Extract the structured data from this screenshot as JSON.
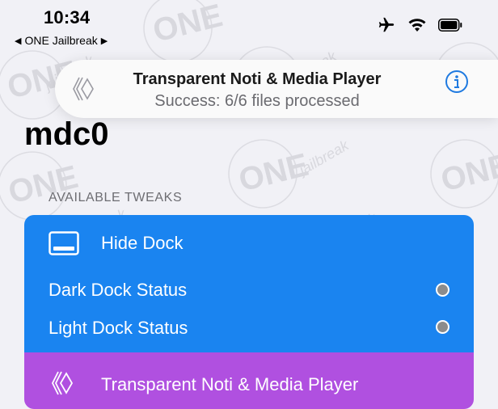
{
  "status_bar": {
    "time": "10:34",
    "back_app": "ONE Jailbreak",
    "icons": [
      "airplane-icon",
      "wifi-icon",
      "battery-icon"
    ]
  },
  "notification": {
    "title": "Transparent Noti & Media Player",
    "subtitle": "Success: 6/6 files processed",
    "icon": "hexagon-logo-icon",
    "info_icon": "info-icon"
  },
  "page": {
    "title": "mdc0",
    "section_label": "AVAILABLE TWEAKS"
  },
  "tweaks": [
    {
      "title": "Hide Dock",
      "icon": "dock-icon",
      "color": "#1a84f0",
      "options": [
        {
          "label": "Dark Dock Status"
        },
        {
          "label": "Light Dock Status"
        }
      ]
    },
    {
      "title": "Transparent Noti & Media Player",
      "icon": "hexagon-logo-icon",
      "color": "#b050e0"
    }
  ],
  "watermark": {
    "brand": "ONE",
    "tag": "jailbreak"
  }
}
